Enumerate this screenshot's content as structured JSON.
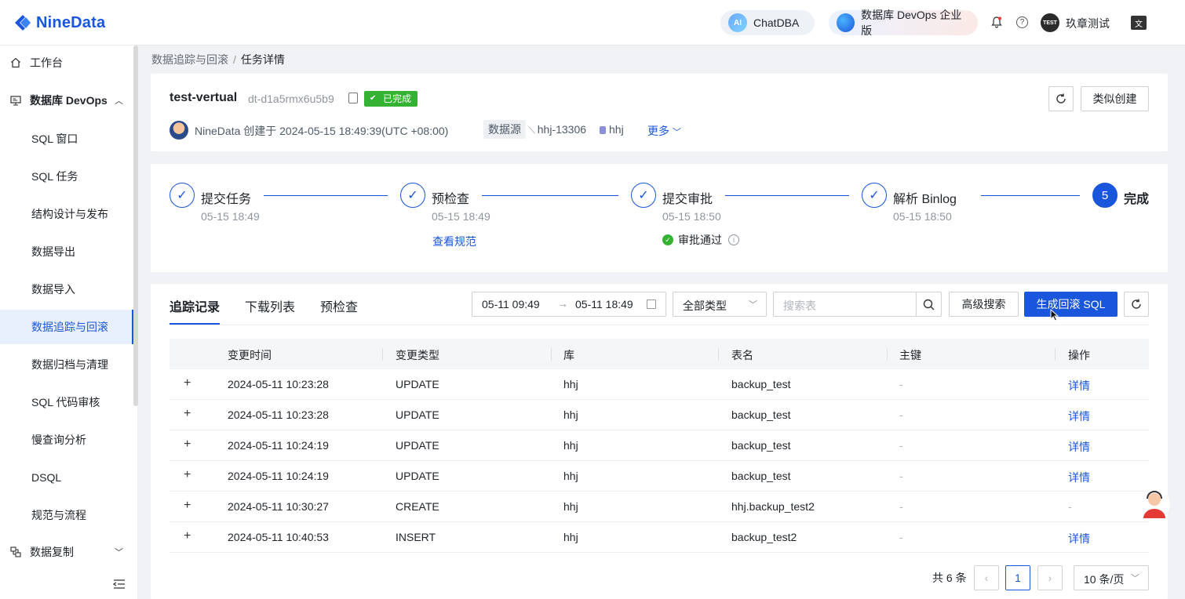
{
  "brand": {
    "name": "NineData"
  },
  "topbar": {
    "chatdba": "ChatDBA",
    "chatdba_icon": "ai-icon",
    "devops": "数据库 DevOps 企业版",
    "user": "玖章测试",
    "avatar_text": "TEST",
    "lang_icon": "文"
  },
  "sidebar": {
    "items": [
      {
        "label": "工作台"
      },
      {
        "label": "数据库 DevOps"
      },
      {
        "label": "SQL 窗口"
      },
      {
        "label": "SQL 任务"
      },
      {
        "label": "结构设计与发布"
      },
      {
        "label": "数据导出"
      },
      {
        "label": "数据导入"
      },
      {
        "label": "数据追踪与回滚"
      },
      {
        "label": "数据归档与清理"
      },
      {
        "label": "SQL 代码审核"
      },
      {
        "label": "慢查询分析"
      },
      {
        "label": "DSQL"
      },
      {
        "label": "规范与流程"
      },
      {
        "label": "数据复制"
      }
    ]
  },
  "breadcrumb": {
    "parent": "数据追踪与回滚",
    "separator": "/",
    "current": "任务详情"
  },
  "task": {
    "title": "test-vertual",
    "id": "dt-d1a5rmx6u5b9",
    "status": "已完成",
    "owner_line": "NineData 创建于 2024-05-15 18:49:39(UTC +08:00)",
    "datasource_label": "数据源",
    "datasource_host": "hhj-13306",
    "datasource_db": "hhj",
    "more": "更多",
    "similar_btn": "类似创建"
  },
  "steps": [
    {
      "title": "提交任务",
      "time": "05-15 18:49"
    },
    {
      "title": "预检查",
      "time": "05-15 18:49",
      "link": "查看规范"
    },
    {
      "title": "提交审批",
      "time": "05-15 18:50",
      "note": "审批通过"
    },
    {
      "title": "解析 Binlog",
      "time": "05-15 18:50"
    },
    {
      "title": "完成",
      "number": "5"
    }
  ],
  "tabs": [
    "追踪记录",
    "下载列表",
    "预检查"
  ],
  "filters": {
    "date_start": "05-11 09:49",
    "date_end": "05-11 18:49",
    "type": "全部类型",
    "search_placeholder": "搜索表",
    "advanced": "高级搜索",
    "generate": "生成回滚 SQL"
  },
  "table": {
    "columns": [
      "变更时间",
      "变更类型",
      "库",
      "表名",
      "主键",
      "操作"
    ],
    "rows": [
      {
        "time": "2024-05-11 10:23:28",
        "type": "UPDATE",
        "db": "hhj",
        "table": "backup_test",
        "pk": "-",
        "action": "详情"
      },
      {
        "time": "2024-05-11 10:23:28",
        "type": "UPDATE",
        "db": "hhj",
        "table": "backup_test",
        "pk": "-",
        "action": "详情"
      },
      {
        "time": "2024-05-11 10:24:19",
        "type": "UPDATE",
        "db": "hhj",
        "table": "backup_test",
        "pk": "-",
        "action": "详情"
      },
      {
        "time": "2024-05-11 10:24:19",
        "type": "UPDATE",
        "db": "hhj",
        "table": "backup_test",
        "pk": "-",
        "action": "详情"
      },
      {
        "time": "2024-05-11 10:30:27",
        "type": "CREATE",
        "db": "hhj",
        "table": "hhj.backup_test2",
        "pk": "-",
        "action": "-"
      },
      {
        "time": "2024-05-11 10:40:53",
        "type": "INSERT",
        "db": "hhj",
        "table": "backup_test2",
        "pk": "-",
        "action": "详情"
      }
    ]
  },
  "pagination": {
    "total": "共 6 条",
    "current": "1",
    "page_size": "10 条/页"
  },
  "colors": {
    "primary": "#1a56db",
    "success": "#34b233"
  }
}
